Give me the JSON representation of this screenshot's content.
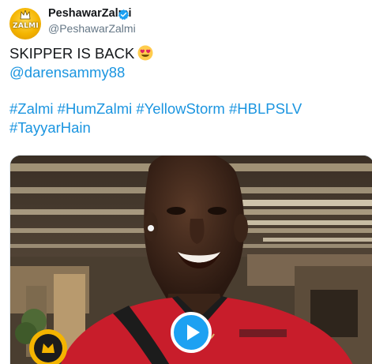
{
  "author": {
    "display_name": "PeshawarZalmi",
    "handle": "@PeshawarZalmi",
    "avatar_label": "ZALMI",
    "verified_icon": "verified-badge-icon"
  },
  "tweet": {
    "line1": "SKIPPER IS BACK",
    "emoji": "heart-eyes-emoji",
    "mention": "@darensammy88",
    "hashtags_line1": [
      "#Zalmi",
      "#HumZalmi",
      "#YellowStorm",
      "#HBLPSLV"
    ],
    "hashtags_line2": [
      "#TayyarHain"
    ]
  },
  "media": {
    "type": "video",
    "play_icon": "play-icon"
  },
  "colors": {
    "link": "#1b95e0",
    "text": "#14171a",
    "muted": "#657786",
    "play_button": "#1da1f2",
    "verified": "#1da1f2",
    "brand_yellow": "#f4b400"
  }
}
